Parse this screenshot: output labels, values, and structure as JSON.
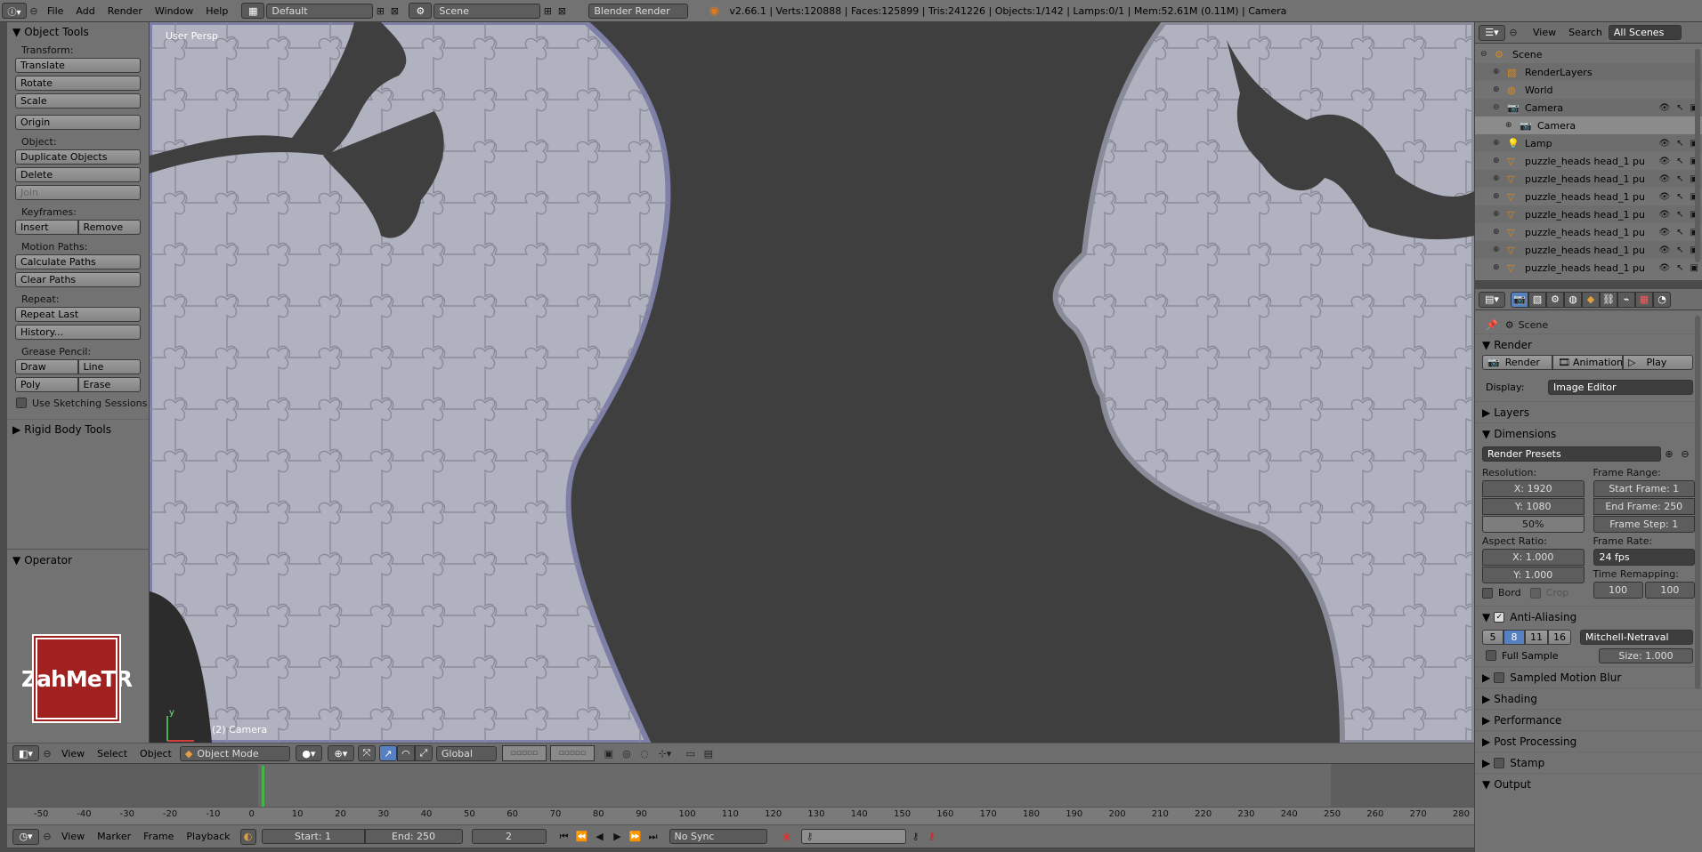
{
  "topbar": {
    "menus": [
      "File",
      "Add",
      "Render",
      "Window",
      "Help"
    ],
    "screen_layout": "Default",
    "scene": "Scene",
    "engine": "Blender Render",
    "stats": "v2.66.1 | Verts:120888 | Faces:125899 | Tris:241226 | Objects:1/142 | Lamps:0/1 | Mem:52.61M (0.11M) | Camera"
  },
  "toolshelf": {
    "title": "Object Tools",
    "transform_label": "Transform:",
    "translate": "Translate",
    "rotate": "Rotate",
    "scale": "Scale",
    "origin": "Origin",
    "object_label": "Object:",
    "duplicate": "Duplicate Objects",
    "delete": "Delete",
    "join": "Join",
    "keyframes_label": "Keyframes:",
    "insert": "Insert",
    "remove": "Remove",
    "motion_label": "Motion Paths:",
    "calc_paths": "Calculate Paths",
    "clear_paths": "Clear Paths",
    "repeat_label": "Repeat:",
    "repeat_last": "Repeat Last",
    "history": "History...",
    "grease_label": "Grease Pencil:",
    "draw": "Draw",
    "line": "Line",
    "poly": "Poly",
    "erase": "Erase",
    "sketching": "Use Sketching Sessions",
    "rigid": "Rigid Body Tools",
    "operator": "Operator"
  },
  "logo_text": "ZahMeTR",
  "viewport": {
    "persp": "User Persp",
    "camera": "(2) Camera",
    "axis_y": "y"
  },
  "vp_header": {
    "view": "View",
    "select": "Select",
    "object": "Object",
    "mode": "Object Mode",
    "orientation": "Global"
  },
  "timeline": {
    "ticks": [
      "-50",
      "-40",
      "-30",
      "-20",
      "-10",
      "0",
      "10",
      "20",
      "30",
      "40",
      "50",
      "60",
      "70",
      "80",
      "90",
      "100",
      "110",
      "120",
      "130",
      "140",
      "150",
      "160",
      "170",
      "180",
      "190",
      "200",
      "210",
      "220",
      "230",
      "240",
      "250",
      "260",
      "270",
      "280"
    ],
    "current_frame_value": 2,
    "end_frame_value": 250
  },
  "tl_header": {
    "view": "View",
    "marker": "Marker",
    "frame": "Frame",
    "playback": "Playback",
    "start": "Start: 1",
    "end": "End: 250",
    "current": "2",
    "sync": "No Sync"
  },
  "outliner": {
    "view": "View",
    "search": "Search",
    "scenes": "All Scenes",
    "items": [
      {
        "label": "Scene",
        "indent": 1
      },
      {
        "label": "RenderLayers",
        "indent": 2
      },
      {
        "label": "World",
        "indent": 2
      },
      {
        "label": "Camera",
        "indent": 2
      },
      {
        "label": "Camera",
        "indent": 3
      },
      {
        "label": "Lamp",
        "indent": 2
      },
      {
        "label": "puzzle_heads head_1 pu",
        "indent": 2
      },
      {
        "label": "puzzle_heads head_1 pu",
        "indent": 2
      },
      {
        "label": "puzzle_heads head_1 pu",
        "indent": 2
      },
      {
        "label": "puzzle_heads head_1 pu",
        "indent": 2
      },
      {
        "label": "puzzle_heads head_1 pu",
        "indent": 2
      },
      {
        "label": "puzzle_heads head_1 pu",
        "indent": 2
      },
      {
        "label": "puzzle_heads head_1 pu",
        "indent": 2
      }
    ]
  },
  "props": {
    "scene": "Scene",
    "render": "Render",
    "render_btn": "Render",
    "animation_btn": "Animation",
    "play_btn": "Play",
    "display_label": "Display:",
    "display": "Image Editor",
    "layers": "Layers",
    "dimensions": "Dimensions",
    "presets": "Render Presets",
    "resolution": "Resolution:",
    "res_x": "X: 1920",
    "res_y": "Y: 1080",
    "res_pct": "50%",
    "frame_range": "Frame Range:",
    "start": "Start Frame: 1",
    "end": "End Frame: 250",
    "step": "Frame Step: 1",
    "aspect": "Aspect Ratio:",
    "asp_x": "X: 1.000",
    "asp_y": "Y: 1.000",
    "frame_rate": "Frame Rate:",
    "fps": "24 fps",
    "time_remap": "Time Remapping:",
    "remap_old": "100",
    "remap_new": "100",
    "bord": "Bord",
    "crop": "Crop",
    "aa": "Anti-Aliasing",
    "aa_samples": [
      "5",
      "8",
      "11",
      "16"
    ],
    "filter": "Mitchell-Netraval",
    "full_sample": "Full Sample",
    "size": "Size: 1.000",
    "motion_blur": "Sampled Motion Blur",
    "shading": "Shading",
    "performance": "Performance",
    "post": "Post Processing",
    "stamp": "Stamp",
    "output": "Output"
  },
  "colors": {
    "accent": "#5680c2",
    "panel": "#727272",
    "viewport_bg": "#3f3f3f",
    "puzzle": "#b4b5c2"
  }
}
